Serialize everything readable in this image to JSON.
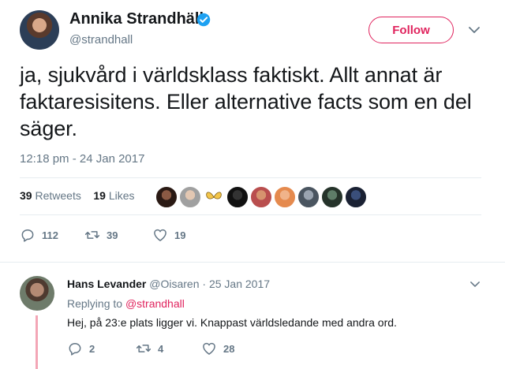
{
  "tweet": {
    "author_name": "Annika Strandhäll",
    "author_handle": "@strandhall",
    "follow_label": "Follow",
    "text": "ja, sjukvård i världsklass faktiskt. Allt annat är faktaresisitens. Eller alternative facts som en del säger.",
    "timestamp": "12:18 pm - 24 Jan 2017",
    "retweets_count": "39",
    "retweets_label": "Retweets",
    "likes_count": "19",
    "likes_label": "Likes",
    "actions": {
      "replies": "112",
      "retweets": "39",
      "likes": "19"
    }
  },
  "reply": {
    "author_name": "Hans Levander",
    "author_handle": "@Oisaren",
    "separator": "·",
    "date": "25 Jan 2017",
    "replying_to_label": "Replying to",
    "replying_to_handle": "@strandhall",
    "text": "Hej, på 23:e plats ligger vi. Knappast världsledande med andra ord.",
    "actions": {
      "replies": "2",
      "retweets": "4",
      "likes": "28"
    }
  },
  "colors": {
    "accent": "#e0245e",
    "verified": "#1da1f2",
    "muted": "#657786",
    "text": "#14171a"
  }
}
